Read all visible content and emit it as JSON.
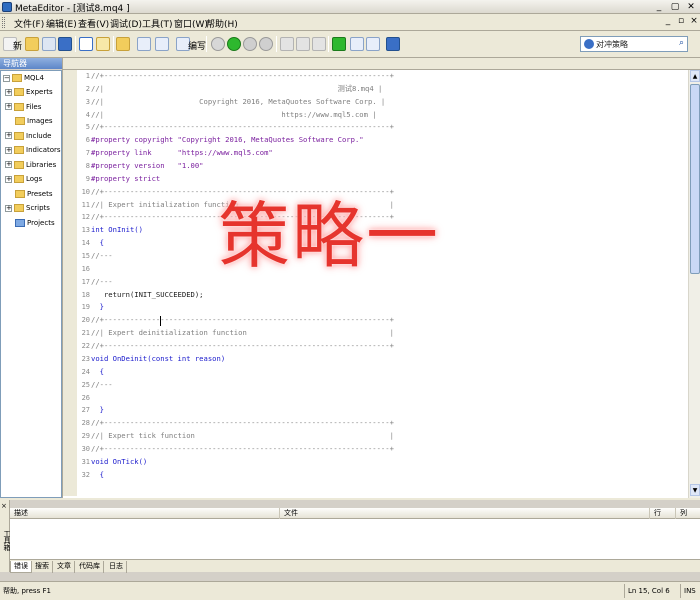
{
  "window": {
    "title": "MetaEditor - [测试8.mq4 ]",
    "controls": [
      "_",
      "▢",
      "✕"
    ]
  },
  "menu": {
    "items": [
      "文件(F)",
      "编辑(E)",
      "查看(V)",
      "调试(D)",
      "工具(T)",
      "窗口(W)",
      "帮助(H)"
    ]
  },
  "toolbar": {
    "new_label": "新",
    "compile_label": "编写",
    "search_placeholder": "对冲策略"
  },
  "navigator": {
    "header": "导航器",
    "root": "MQL4",
    "items": [
      {
        "label": "Experts",
        "expandable": true
      },
      {
        "label": "Files",
        "expandable": true
      },
      {
        "label": "Images",
        "expandable": false
      },
      {
        "label": "Include",
        "expandable": true
      },
      {
        "label": "Indicators",
        "expandable": true
      },
      {
        "label": "Libraries",
        "expandable": true
      },
      {
        "label": "Logs",
        "expandable": true
      },
      {
        "label": "Presets",
        "expandable": false
      },
      {
        "label": "Scripts",
        "expandable": true
      },
      {
        "label": "Projects",
        "expandable": false
      }
    ]
  },
  "editor": {
    "line_numbers": [
      "1",
      "2",
      "3",
      "4",
      "5",
      "6",
      "7",
      "8",
      "9",
      "10",
      "11",
      "12",
      "13",
      "14",
      "15",
      "16",
      "17",
      "18",
      "19",
      "20",
      "21",
      "22",
      "23",
      "24",
      "25",
      "26",
      "27",
      "28",
      "29",
      "30",
      "31",
      "32"
    ],
    "lines": [
      {
        "cls": "c-comment",
        "text": "//+------------------------------------------------------------------+"
      },
      {
        "cls": "c-comment",
        "text": "//|                                                      测试8.mq4 |"
      },
      {
        "cls": "c-comment",
        "text": "//|                      Copyright 2016, MetaQuotes Software Corp. |"
      },
      {
        "cls": "c-comment",
        "text": "//|                                         https://www.mql5.com |"
      },
      {
        "cls": "c-comment",
        "text": "//+------------------------------------------------------------------+"
      },
      {
        "cls": "c-pre",
        "text": "#property copyright \"Copyright 2016, MetaQuotes Software Corp.\""
      },
      {
        "cls": "c-pre",
        "text": "#property link      \"https://www.mql5.com\""
      },
      {
        "cls": "c-pre",
        "text": "#property version   \"1.00\""
      },
      {
        "cls": "c-pre",
        "text": "#property strict"
      },
      {
        "cls": "c-comment",
        "text": "//+------------------------------------------------------------------+"
      },
      {
        "cls": "c-comment",
        "text": "//| Expert initialization function                                   |"
      },
      {
        "cls": "c-comment",
        "text": "//+------------------------------------------------------------------+"
      },
      {
        "cls": "c-kw",
        "text": "int OnInit()"
      },
      {
        "cls": "c-kw",
        "text": "  {"
      },
      {
        "cls": "c-comment",
        "text": "//---"
      },
      {
        "cls": "c-comment",
        "text": ""
      },
      {
        "cls": "c-comment",
        "text": "//---"
      },
      {
        "cls": "c-norm",
        "text": "   return(INIT_SUCCEEDED);"
      },
      {
        "cls": "c-kw",
        "text": "  }"
      },
      {
        "cls": "c-comment",
        "text": "//+------------------------------------------------------------------+"
      },
      {
        "cls": "c-comment",
        "text": "//| Expert deinitialization function                                 |"
      },
      {
        "cls": "c-comment",
        "text": "//+------------------------------------------------------------------+"
      },
      {
        "cls": "c-kw",
        "text": "void OnDeinit(const int reason)"
      },
      {
        "cls": "c-kw",
        "text": "  {"
      },
      {
        "cls": "c-comment",
        "text": "//---"
      },
      {
        "cls": "c-comment",
        "text": ""
      },
      {
        "cls": "c-kw",
        "text": "  }"
      },
      {
        "cls": "c-comment",
        "text": "//+------------------------------------------------------------------+"
      },
      {
        "cls": "c-comment",
        "text": "//| Expert tick function                                             |"
      },
      {
        "cls": "c-comment",
        "text": "//+------------------------------------------------------------------+"
      },
      {
        "cls": "c-kw",
        "text": "void OnTick()"
      },
      {
        "cls": "c-kw",
        "text": "  {"
      }
    ]
  },
  "overlay": {
    "text": "策略一"
  },
  "toolbox": {
    "side_label": "工具箱",
    "columns": [
      "描述",
      "文件",
      "行",
      "列"
    ],
    "tabs": [
      "错误",
      "搜索",
      "文章",
      "代码库",
      "日志"
    ],
    "active_tab": 0
  },
  "status": {
    "help": "帮助, press F1",
    "position": "Ln 15, Col 6",
    "mode": "INS"
  },
  "colors": {
    "accent": "#2f6cc0",
    "overlay_red": "#e6342d"
  }
}
